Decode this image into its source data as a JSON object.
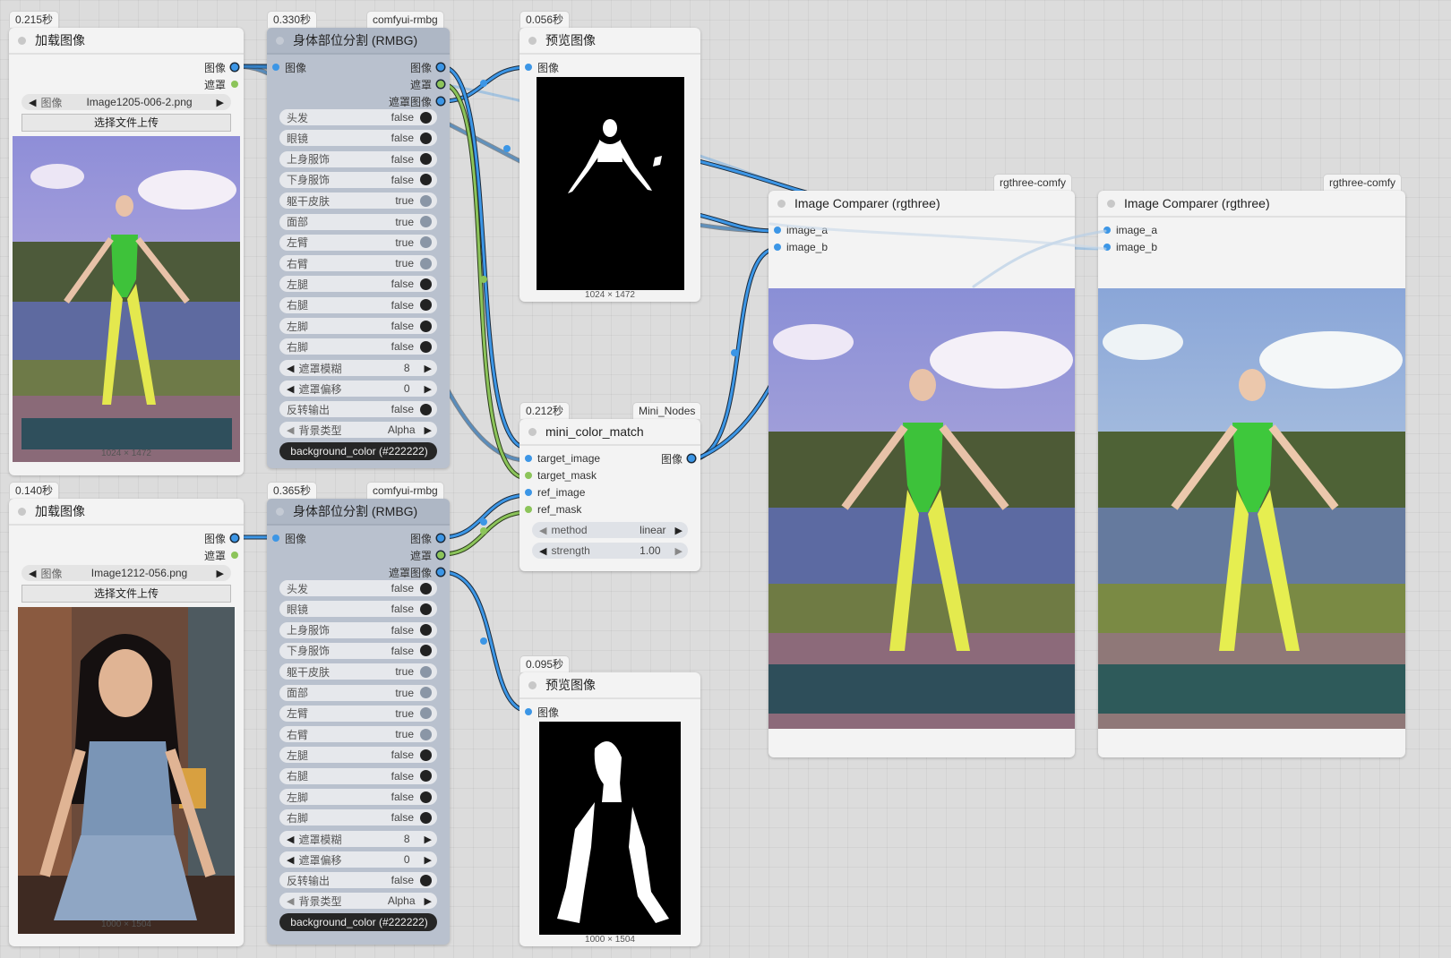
{
  "colors": {
    "wire_blue": "#3c96e6",
    "wire_green": "#8cc45a",
    "canvas": "#dcdcdc",
    "rmbg_node": "#b9c1ce"
  },
  "load1": {
    "time": "0.215秒",
    "title": "加载图像",
    "out_image": "图像",
    "out_mask": "遮罩",
    "file_label": "图像",
    "file_value": "Image1205-006-2.png",
    "upload_label": "选择文件上传",
    "dims": "1024 × 1472"
  },
  "load2": {
    "time": "0.140秒",
    "title": "加载图像",
    "out_image": "图像",
    "out_mask": "遮罩",
    "file_label": "图像",
    "file_value": "Image1212-056.png",
    "upload_label": "选择文件上传",
    "dims": "1000 × 1504"
  },
  "rmbg1": {
    "time": "0.330秒",
    "pack": "comfyui-rmbg",
    "title": "身体部位分割 (RMBG)",
    "in_image": "图像",
    "out_image": "图像",
    "out_mask": "遮罩",
    "out_mask_image": "遮罩图像",
    "toggles": [
      {
        "label": "头发",
        "value": "false"
      },
      {
        "label": "眼镜",
        "value": "false"
      },
      {
        "label": "上身服饰",
        "value": "false"
      },
      {
        "label": "下身服饰",
        "value": "false"
      },
      {
        "label": "躯干皮肤",
        "value": "true"
      },
      {
        "label": "面部",
        "value": "true"
      },
      {
        "label": "左臂",
        "value": "true"
      },
      {
        "label": "右臂",
        "value": "true"
      },
      {
        "label": "左腿",
        "value": "false"
      },
      {
        "label": "右腿",
        "value": "false"
      },
      {
        "label": "左脚",
        "value": "false"
      },
      {
        "label": "右脚",
        "value": "false"
      }
    ],
    "blur_label": "遮罩模糊",
    "blur_value": "8",
    "offset_label": "遮罩偏移",
    "offset_value": "0",
    "invert_label": "反转输出",
    "invert_value": "false",
    "bg_label": "背景类型",
    "bg_value": "Alpha",
    "bg_color_button": "background_color (#222222)"
  },
  "rmbg2": {
    "time": "0.365秒",
    "pack": "comfyui-rmbg",
    "title": "身体部位分割 (RMBG)",
    "in_image": "图像",
    "out_image": "图像",
    "out_mask": "遮罩",
    "out_mask_image": "遮罩图像",
    "toggles": [
      {
        "label": "头发",
        "value": "false"
      },
      {
        "label": "眼镜",
        "value": "false"
      },
      {
        "label": "上身服饰",
        "value": "false"
      },
      {
        "label": "下身服饰",
        "value": "false"
      },
      {
        "label": "躯干皮肤",
        "value": "true"
      },
      {
        "label": "面部",
        "value": "true"
      },
      {
        "label": "左臂",
        "value": "true"
      },
      {
        "label": "右臂",
        "value": "true"
      },
      {
        "label": "左腿",
        "value": "false"
      },
      {
        "label": "右腿",
        "value": "false"
      },
      {
        "label": "左脚",
        "value": "false"
      },
      {
        "label": "右脚",
        "value": "false"
      }
    ],
    "blur_label": "遮罩模糊",
    "blur_value": "8",
    "offset_label": "遮罩偏移",
    "offset_value": "0",
    "invert_label": "反转输出",
    "invert_value": "false",
    "bg_label": "背景类型",
    "bg_value": "Alpha",
    "bg_color_button": "background_color (#222222)"
  },
  "preview1": {
    "time": "0.056秒",
    "title": "预览图像",
    "in_image": "图像",
    "dims": "1024 × 1472"
  },
  "preview2": {
    "time": "0.095秒",
    "title": "预览图像",
    "in_image": "图像",
    "dims": "1000 × 1504"
  },
  "colormatch": {
    "time": "0.212秒",
    "pack": "Mini_Nodes",
    "title": "mini_color_match",
    "inputs": [
      "target_image",
      "target_mask",
      "ref_image",
      "ref_mask"
    ],
    "out_image": "图像",
    "method_label": "method",
    "method_value": "linear",
    "strength_label": "strength",
    "strength_value": "1.00"
  },
  "comparer1": {
    "pack": "rgthree-comfy",
    "title": "Image Comparer (rgthree)",
    "in_a": "image_a",
    "in_b": "image_b"
  },
  "comparer2": {
    "pack": "rgthree-comfy",
    "title": "Image Comparer (rgthree)",
    "in_a": "image_a",
    "in_b": "image_b"
  }
}
